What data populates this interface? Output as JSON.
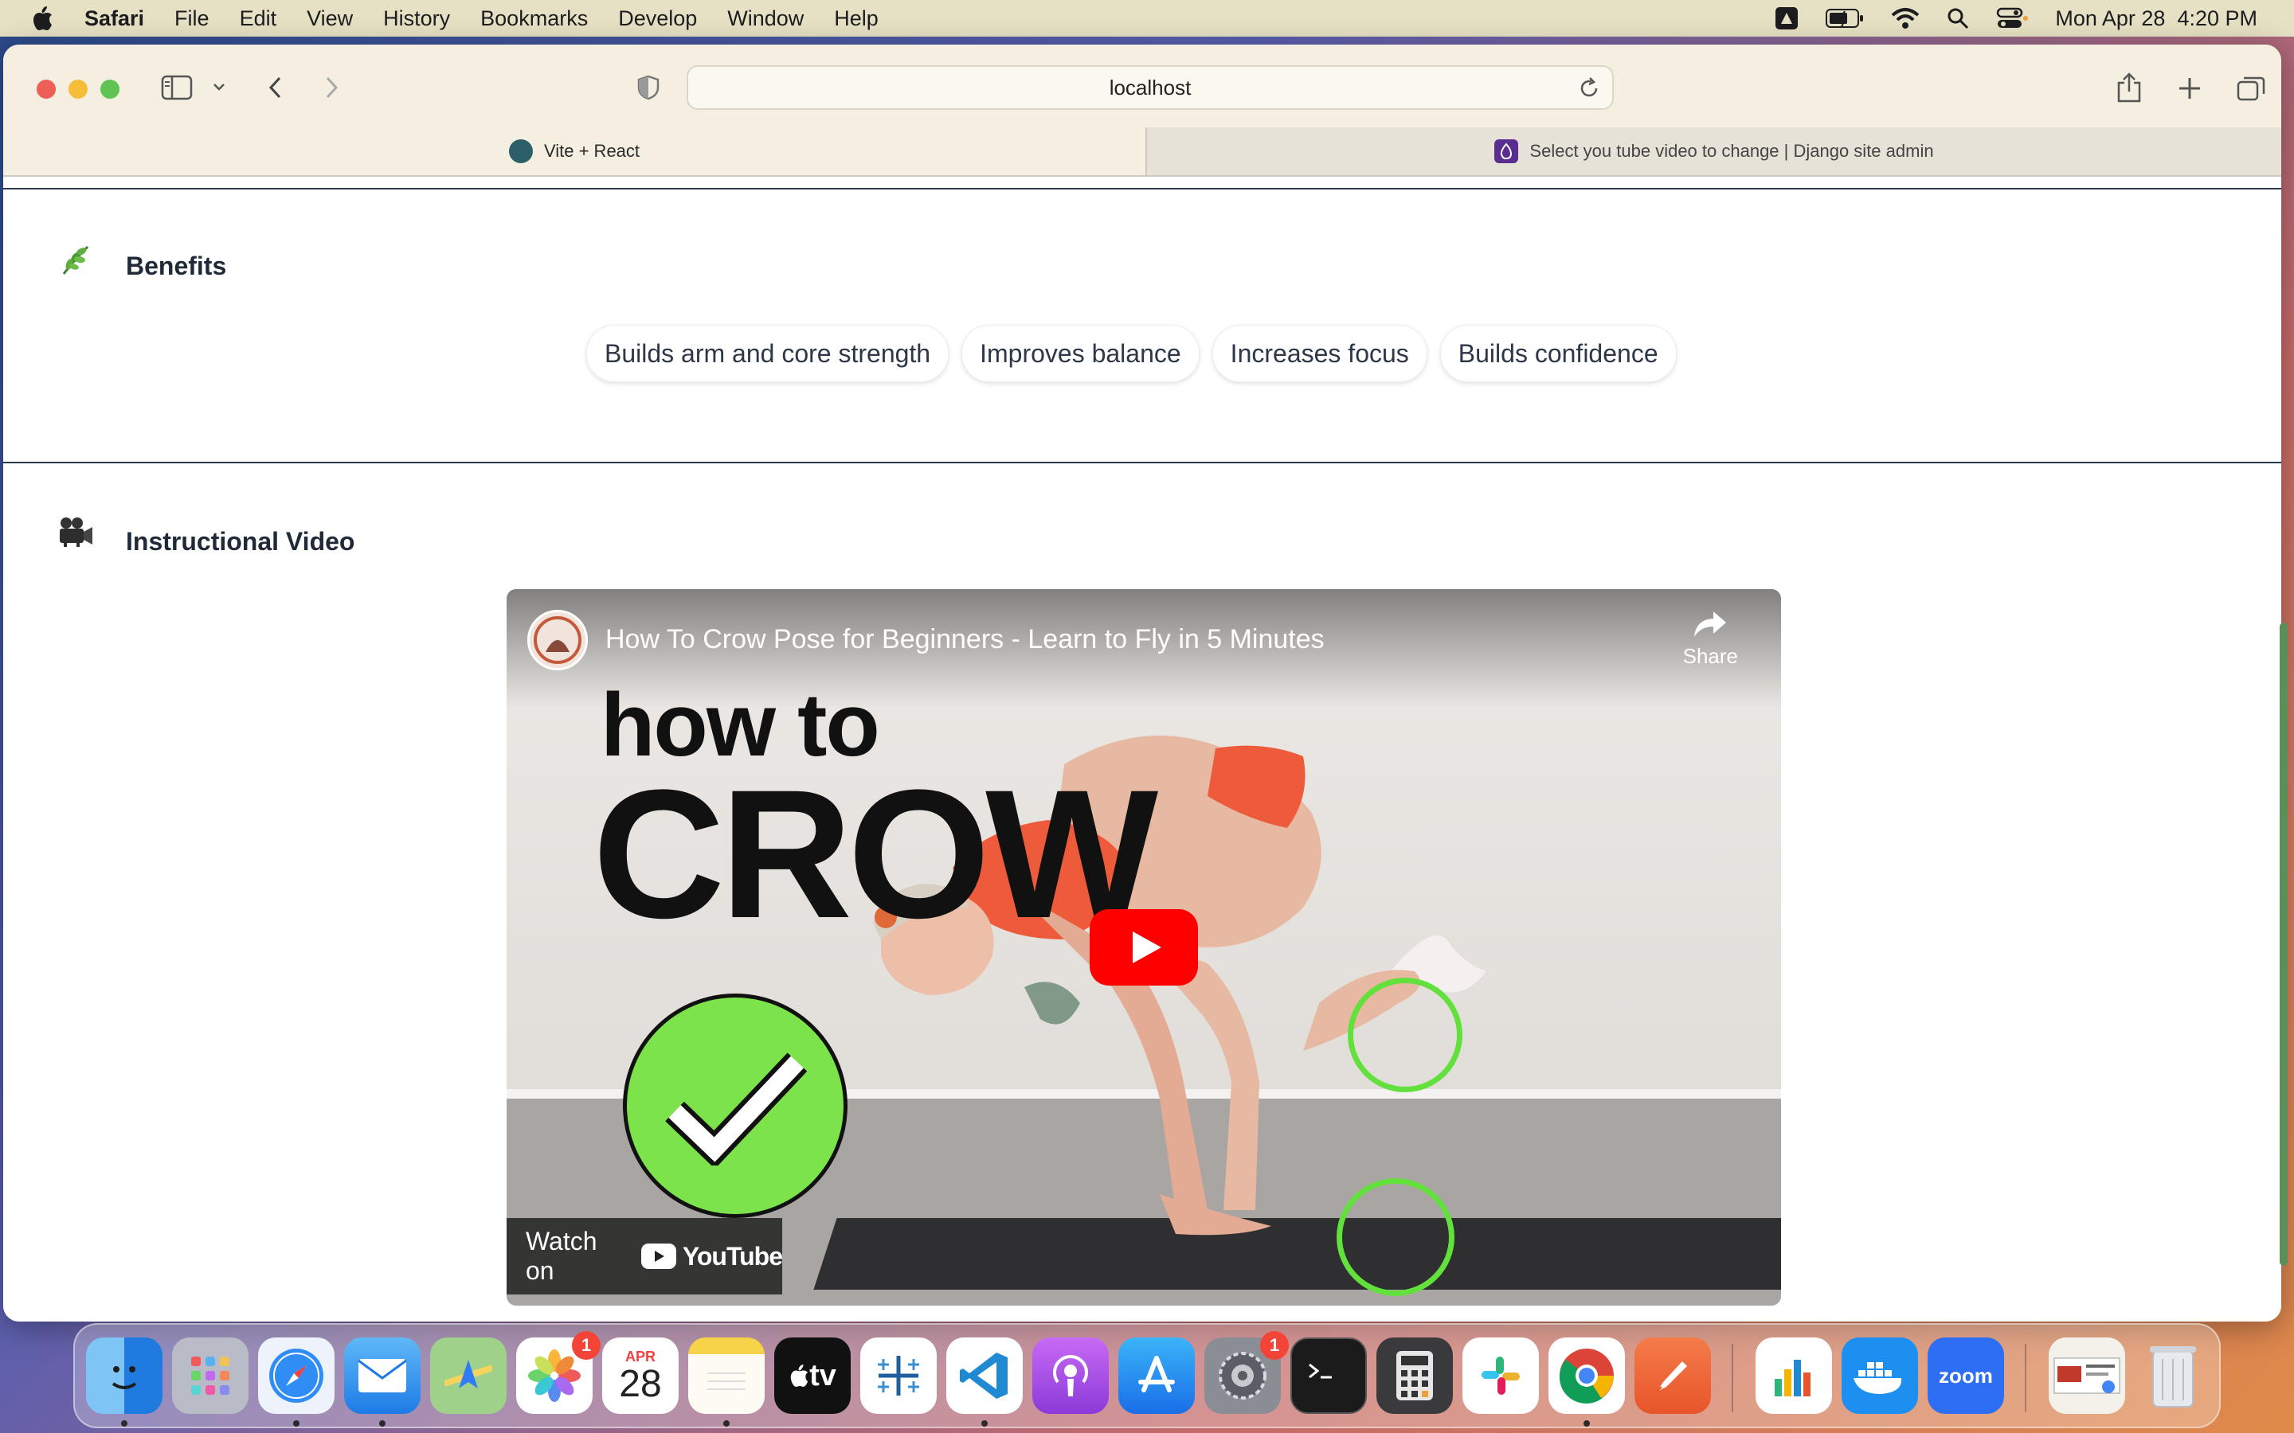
{
  "menubar": {
    "app_name": "Safari",
    "items": [
      "File",
      "Edit",
      "View",
      "History",
      "Bookmarks",
      "Develop",
      "Window",
      "Help"
    ],
    "clock": "Mon Apr 28  4:20 PM"
  },
  "browser": {
    "address": "localhost",
    "tabs": [
      {
        "label": "Vite + React"
      },
      {
        "label": "Select you tube video to change | Django site admin"
      }
    ]
  },
  "page": {
    "benefits": {
      "title": "Benefits",
      "icon": "herb-icon",
      "chips": [
        "Builds arm and core strength",
        "Improves balance",
        "Increases focus",
        "Builds confidence"
      ]
    },
    "video_section": {
      "title": "Instructional Video",
      "icon": "movie-camera-icon"
    },
    "video": {
      "title": "How To Crow Pose for Beginners - Learn to Fly in 5 Minutes",
      "share_label": "Share",
      "thumbnail_line1": "how to",
      "thumbnail_line2": "CROW",
      "watch_on_label": "Watch on",
      "youtube_label": "YouTube"
    }
  },
  "dock": {
    "calendar_month": "APR",
    "calendar_day": "28",
    "photos_badge": "1",
    "settings_badge": "1",
    "tv_label": "tv",
    "zoom_label": "zoom",
    "apps": [
      "finder",
      "launchpad",
      "safari",
      "mail",
      "maps",
      "photos",
      "calendar",
      "notes",
      "apple-tv",
      "tableau",
      "vscode",
      "podcasts",
      "app-store",
      "system-settings",
      "terminal",
      "calculator",
      "slack",
      "chrome",
      "pen-app",
      "numbers",
      "docker",
      "zoom",
      "preview",
      "trash"
    ]
  },
  "colors": {
    "menubar_bg": "#e6e1c4",
    "toolbar_bg": "#f4efe1",
    "divider": "#2c3a4f",
    "youtube_red": "#ff0000",
    "ring_green": "#62e03c"
  }
}
